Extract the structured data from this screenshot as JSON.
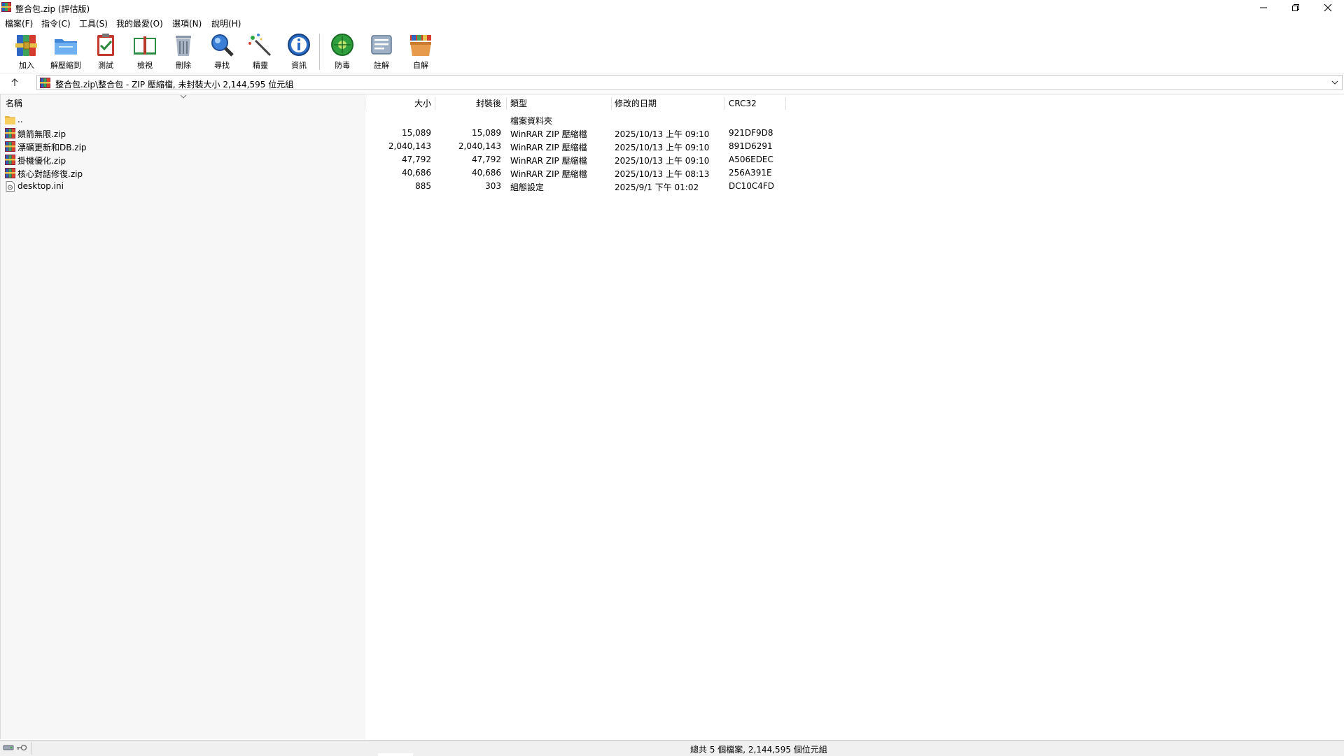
{
  "window": {
    "title": "整合包.zip (評估版)",
    "controls": {
      "minimize": "—",
      "maximize": "❐",
      "close": "✕"
    }
  },
  "menu": [
    "檔案(F)",
    "指令(C)",
    "工具(S)",
    "我的最愛(O)",
    "選項(N)",
    "說明(H)"
  ],
  "toolbar": {
    "add": "加入",
    "extract": "解壓縮到",
    "test": "測試",
    "view": "檢視",
    "delete": "刪除",
    "find": "尋找",
    "wizard": "精靈",
    "info": "資訊",
    "virus": "防毒",
    "comment": "註解",
    "sfx": "自解"
  },
  "address": {
    "text": "整合包.zip\\整合包 - ZIP 壓縮檔, 未封裝大小 2,144,595 位元組"
  },
  "columns": {
    "name": "名稱",
    "size": "大小",
    "packed": "封裝後",
    "type": "類型",
    "modified": "修改的日期",
    "crc": "CRC32"
  },
  "files": [
    {
      "name": "..",
      "size": "",
      "packed": "",
      "type": "檔案資料夾",
      "modified": "",
      "crc": "",
      "icon": "folder-icon"
    },
    {
      "name": "鎖箭無限.zip",
      "size": "15,089",
      "packed": "15,089",
      "type": "WinRAR ZIP 壓縮檔",
      "modified": "2025/10/13 上午 09:10",
      "crc": "921DF9D8",
      "icon": "zip-archive-icon"
    },
    {
      "name": "漂礪更新和DB.zip",
      "size": "2,040,143",
      "packed": "2,040,143",
      "type": "WinRAR ZIP 壓縮檔",
      "modified": "2025/10/13 上午 09:10",
      "crc": "891D6291",
      "icon": "zip-archive-icon"
    },
    {
      "name": "掛機優化.zip",
      "size": "47,792",
      "packed": "47,792",
      "type": "WinRAR ZIP 壓縮檔",
      "modified": "2025/10/13 上午 09:10",
      "crc": "A506EDEC",
      "icon": "zip-archive-icon"
    },
    {
      "name": "核心對話修復.zip",
      "size": "40,686",
      "packed": "40,686",
      "type": "WinRAR ZIP 壓縮檔",
      "modified": "2025/10/13 上午 08:13",
      "crc": "256A391E",
      "icon": "zip-archive-icon"
    },
    {
      "name": "desktop.ini",
      "size": "885",
      "packed": "303",
      "type": "組態設定",
      "modified": "2025/9/1 下午 01:02",
      "crc": "DC10C4FD",
      "icon": "ini-file-icon"
    }
  ],
  "status": {
    "text": "總共 5 個檔案, 2,144,595 個位元組"
  }
}
